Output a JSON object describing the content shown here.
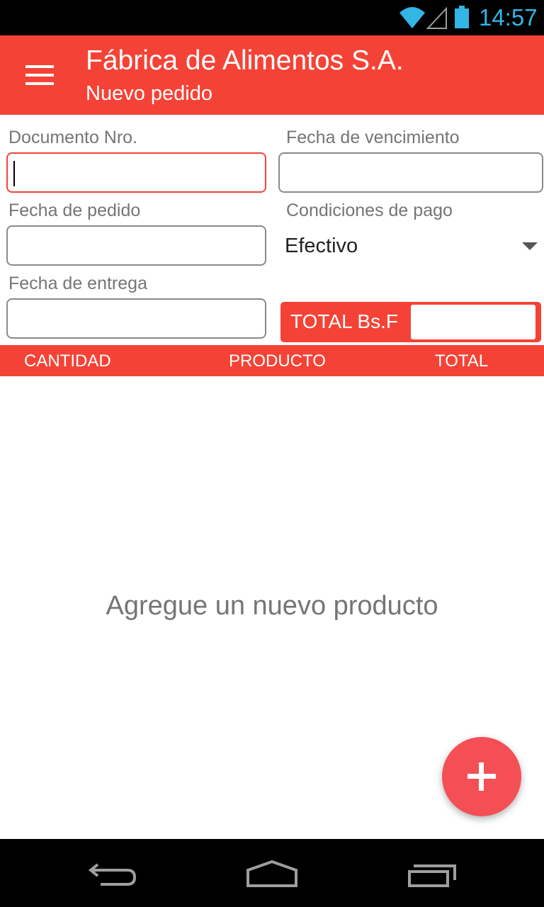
{
  "status_bar": {
    "time": "14:57",
    "icons": [
      "wifi-icon",
      "signal-icon",
      "battery-icon"
    ],
    "accent_color": "#33b5e5"
  },
  "app_bar": {
    "title": "Fábrica de Alimentos S.A.",
    "subtitle": "Nuevo pedido",
    "color": "#f44336",
    "menu_icon": "menu-icon"
  },
  "form": {
    "documento": {
      "label": "Documento Nro.",
      "value": ""
    },
    "fecha_vencimiento": {
      "label": "Fecha de vencimiento",
      "value": ""
    },
    "fecha_pedido": {
      "label": "Fecha de pedido",
      "value": ""
    },
    "condiciones_pago": {
      "label": "Condiciones de pago",
      "selected": "Efectivo"
    },
    "fecha_entrega": {
      "label": "Fecha de entrega",
      "value": ""
    },
    "total": {
      "label": "TOTAL Bs.F",
      "value": ""
    }
  },
  "table": {
    "columns": [
      "CANTIDAD",
      "PRODUCTO",
      "TOTAL"
    ],
    "rows": [],
    "empty_message": "Agregue un nuevo producto"
  },
  "fab": {
    "icon": "plus-icon"
  },
  "nav_bar": {
    "icons": [
      "back-icon",
      "home-icon",
      "recent-apps-icon"
    ]
  }
}
